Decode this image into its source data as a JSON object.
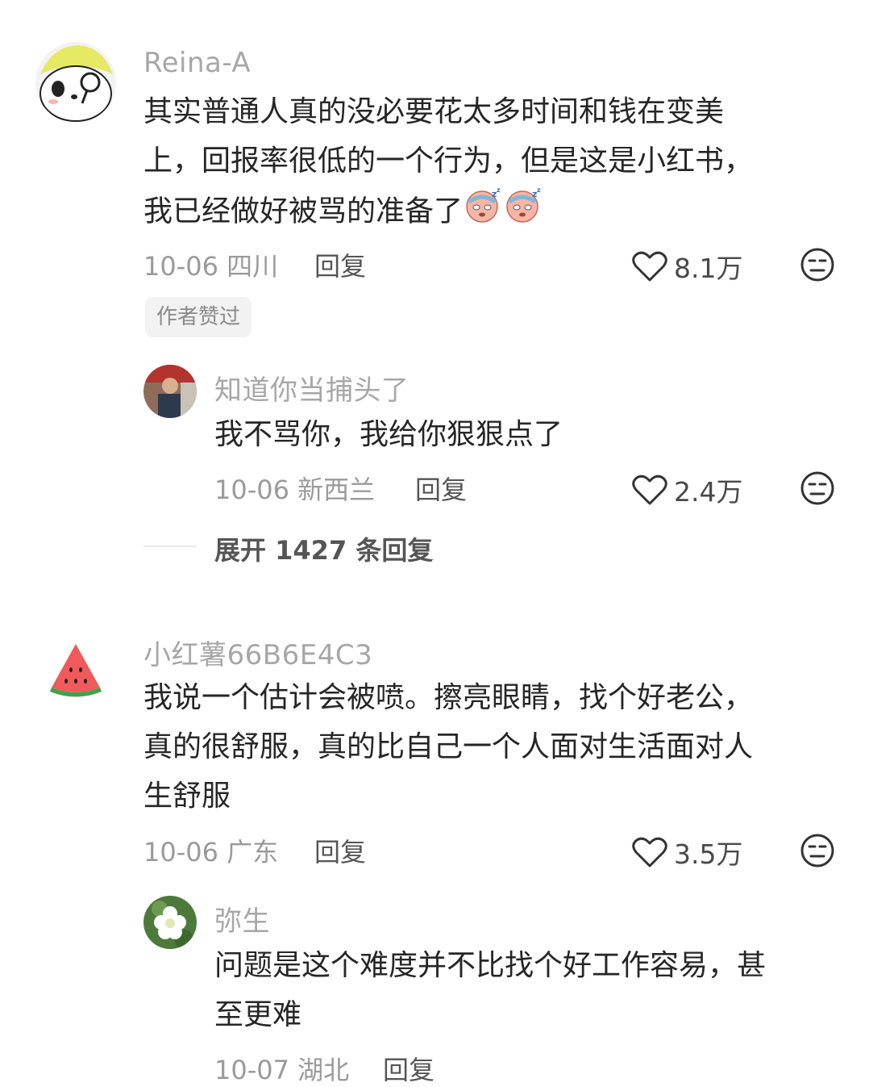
{
  "comments": [
    {
      "author": "Reina-A",
      "lines": [
        "其实普通人真的没必要花太多时间和钱在变美",
        "上，回报率很低的一个行为，但是这是小红书，",
        "我已经做好被骂的准备了"
      ],
      "emojis": [
        "sleepy-face-emoji",
        "sleepy-face-emoji"
      ],
      "date": "10-06",
      "location": "四川",
      "reply_label": "回复",
      "likes": "8.1万",
      "badge": "作者赞过",
      "replies": [
        {
          "author": "知道你当捕头了",
          "lines": [
            "我不骂你，我给你狠狠点了"
          ],
          "date": "10-06",
          "location": "新西兰",
          "reply_label": "回复",
          "likes": "2.4万"
        }
      ],
      "expand_label": "展开 1427 条回复"
    },
    {
      "author": "小红薯66B6E4C3",
      "lines": [
        "我说一个估计会被喷。擦亮眼睛，找个好老公，",
        "真的很舒服，真的比自己一个人面对生活面对人",
        "生舒服"
      ],
      "date": "10-06",
      "location": "广东",
      "reply_label": "回复",
      "likes": "3.5万",
      "replies": [
        {
          "author": "弥生",
          "lines": [
            "问题是这个难度并不比找个好工作容易，甚",
            "至更难"
          ],
          "date": "10-07",
          "location": "湖北",
          "reply_label": "回复"
        }
      ]
    }
  ],
  "colors": {
    "text": "#262626",
    "meta": "#9a9a9a",
    "author": "#a7a7a7",
    "badge_bg": "#f2f2f2"
  }
}
